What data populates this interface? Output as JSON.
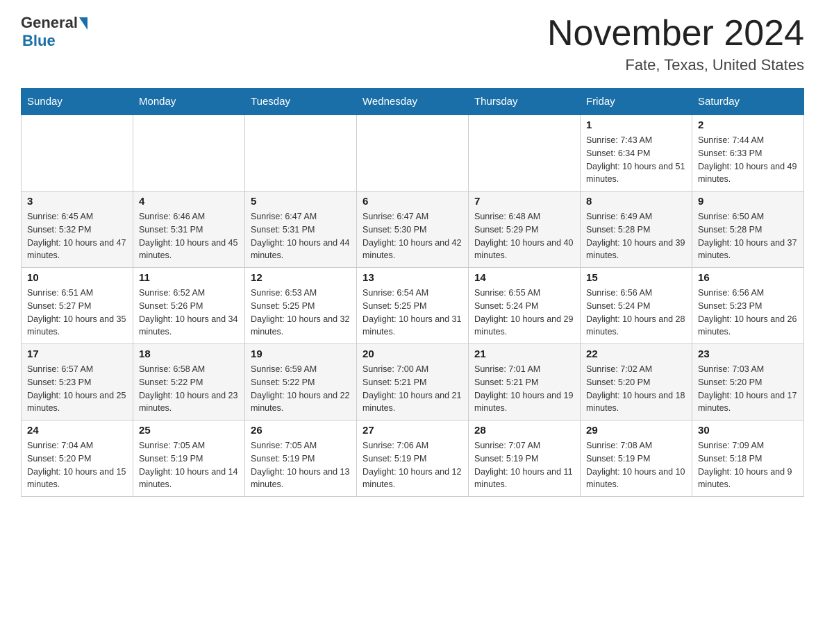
{
  "logo": {
    "general": "General",
    "blue": "Blue"
  },
  "header": {
    "month": "November 2024",
    "location": "Fate, Texas, United States"
  },
  "weekdays": [
    "Sunday",
    "Monday",
    "Tuesday",
    "Wednesday",
    "Thursday",
    "Friday",
    "Saturday"
  ],
  "weeks": [
    [
      {
        "day": "",
        "info": ""
      },
      {
        "day": "",
        "info": ""
      },
      {
        "day": "",
        "info": ""
      },
      {
        "day": "",
        "info": ""
      },
      {
        "day": "",
        "info": ""
      },
      {
        "day": "1",
        "info": "Sunrise: 7:43 AM\nSunset: 6:34 PM\nDaylight: 10 hours and 51 minutes."
      },
      {
        "day": "2",
        "info": "Sunrise: 7:44 AM\nSunset: 6:33 PM\nDaylight: 10 hours and 49 minutes."
      }
    ],
    [
      {
        "day": "3",
        "info": "Sunrise: 6:45 AM\nSunset: 5:32 PM\nDaylight: 10 hours and 47 minutes."
      },
      {
        "day": "4",
        "info": "Sunrise: 6:46 AM\nSunset: 5:31 PM\nDaylight: 10 hours and 45 minutes."
      },
      {
        "day": "5",
        "info": "Sunrise: 6:47 AM\nSunset: 5:31 PM\nDaylight: 10 hours and 44 minutes."
      },
      {
        "day": "6",
        "info": "Sunrise: 6:47 AM\nSunset: 5:30 PM\nDaylight: 10 hours and 42 minutes."
      },
      {
        "day": "7",
        "info": "Sunrise: 6:48 AM\nSunset: 5:29 PM\nDaylight: 10 hours and 40 minutes."
      },
      {
        "day": "8",
        "info": "Sunrise: 6:49 AM\nSunset: 5:28 PM\nDaylight: 10 hours and 39 minutes."
      },
      {
        "day": "9",
        "info": "Sunrise: 6:50 AM\nSunset: 5:28 PM\nDaylight: 10 hours and 37 minutes."
      }
    ],
    [
      {
        "day": "10",
        "info": "Sunrise: 6:51 AM\nSunset: 5:27 PM\nDaylight: 10 hours and 35 minutes."
      },
      {
        "day": "11",
        "info": "Sunrise: 6:52 AM\nSunset: 5:26 PM\nDaylight: 10 hours and 34 minutes."
      },
      {
        "day": "12",
        "info": "Sunrise: 6:53 AM\nSunset: 5:25 PM\nDaylight: 10 hours and 32 minutes."
      },
      {
        "day": "13",
        "info": "Sunrise: 6:54 AM\nSunset: 5:25 PM\nDaylight: 10 hours and 31 minutes."
      },
      {
        "day": "14",
        "info": "Sunrise: 6:55 AM\nSunset: 5:24 PM\nDaylight: 10 hours and 29 minutes."
      },
      {
        "day": "15",
        "info": "Sunrise: 6:56 AM\nSunset: 5:24 PM\nDaylight: 10 hours and 28 minutes."
      },
      {
        "day": "16",
        "info": "Sunrise: 6:56 AM\nSunset: 5:23 PM\nDaylight: 10 hours and 26 minutes."
      }
    ],
    [
      {
        "day": "17",
        "info": "Sunrise: 6:57 AM\nSunset: 5:23 PM\nDaylight: 10 hours and 25 minutes."
      },
      {
        "day": "18",
        "info": "Sunrise: 6:58 AM\nSunset: 5:22 PM\nDaylight: 10 hours and 23 minutes."
      },
      {
        "day": "19",
        "info": "Sunrise: 6:59 AM\nSunset: 5:22 PM\nDaylight: 10 hours and 22 minutes."
      },
      {
        "day": "20",
        "info": "Sunrise: 7:00 AM\nSunset: 5:21 PM\nDaylight: 10 hours and 21 minutes."
      },
      {
        "day": "21",
        "info": "Sunrise: 7:01 AM\nSunset: 5:21 PM\nDaylight: 10 hours and 19 minutes."
      },
      {
        "day": "22",
        "info": "Sunrise: 7:02 AM\nSunset: 5:20 PM\nDaylight: 10 hours and 18 minutes."
      },
      {
        "day": "23",
        "info": "Sunrise: 7:03 AM\nSunset: 5:20 PM\nDaylight: 10 hours and 17 minutes."
      }
    ],
    [
      {
        "day": "24",
        "info": "Sunrise: 7:04 AM\nSunset: 5:20 PM\nDaylight: 10 hours and 15 minutes."
      },
      {
        "day": "25",
        "info": "Sunrise: 7:05 AM\nSunset: 5:19 PM\nDaylight: 10 hours and 14 minutes."
      },
      {
        "day": "26",
        "info": "Sunrise: 7:05 AM\nSunset: 5:19 PM\nDaylight: 10 hours and 13 minutes."
      },
      {
        "day": "27",
        "info": "Sunrise: 7:06 AM\nSunset: 5:19 PM\nDaylight: 10 hours and 12 minutes."
      },
      {
        "day": "28",
        "info": "Sunrise: 7:07 AM\nSunset: 5:19 PM\nDaylight: 10 hours and 11 minutes."
      },
      {
        "day": "29",
        "info": "Sunrise: 7:08 AM\nSunset: 5:19 PM\nDaylight: 10 hours and 10 minutes."
      },
      {
        "day": "30",
        "info": "Sunrise: 7:09 AM\nSunset: 5:18 PM\nDaylight: 10 hours and 9 minutes."
      }
    ]
  ]
}
